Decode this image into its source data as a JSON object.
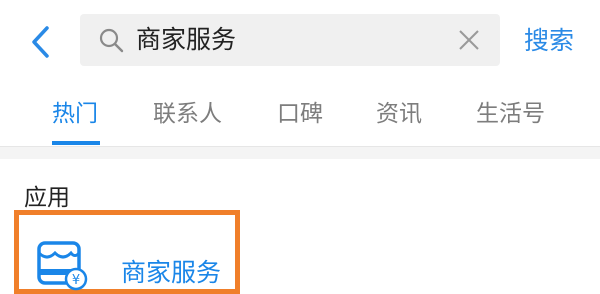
{
  "search": {
    "value": "商家服务",
    "submit_label": "搜索"
  },
  "tabs": [
    {
      "label": "热门",
      "active": true
    },
    {
      "label": "联系人",
      "active": false
    },
    {
      "label": "口碑",
      "active": false
    },
    {
      "label": "资讯",
      "active": false
    },
    {
      "label": "生活号",
      "active": false
    }
  ],
  "results": {
    "section_title": "应用",
    "app": {
      "label": "商家服务",
      "icon": "merchant-store-icon"
    }
  },
  "colors": {
    "accent": "#1a86e8",
    "highlight_border": "#f07f2a",
    "search_bg": "#f0f0f0"
  }
}
